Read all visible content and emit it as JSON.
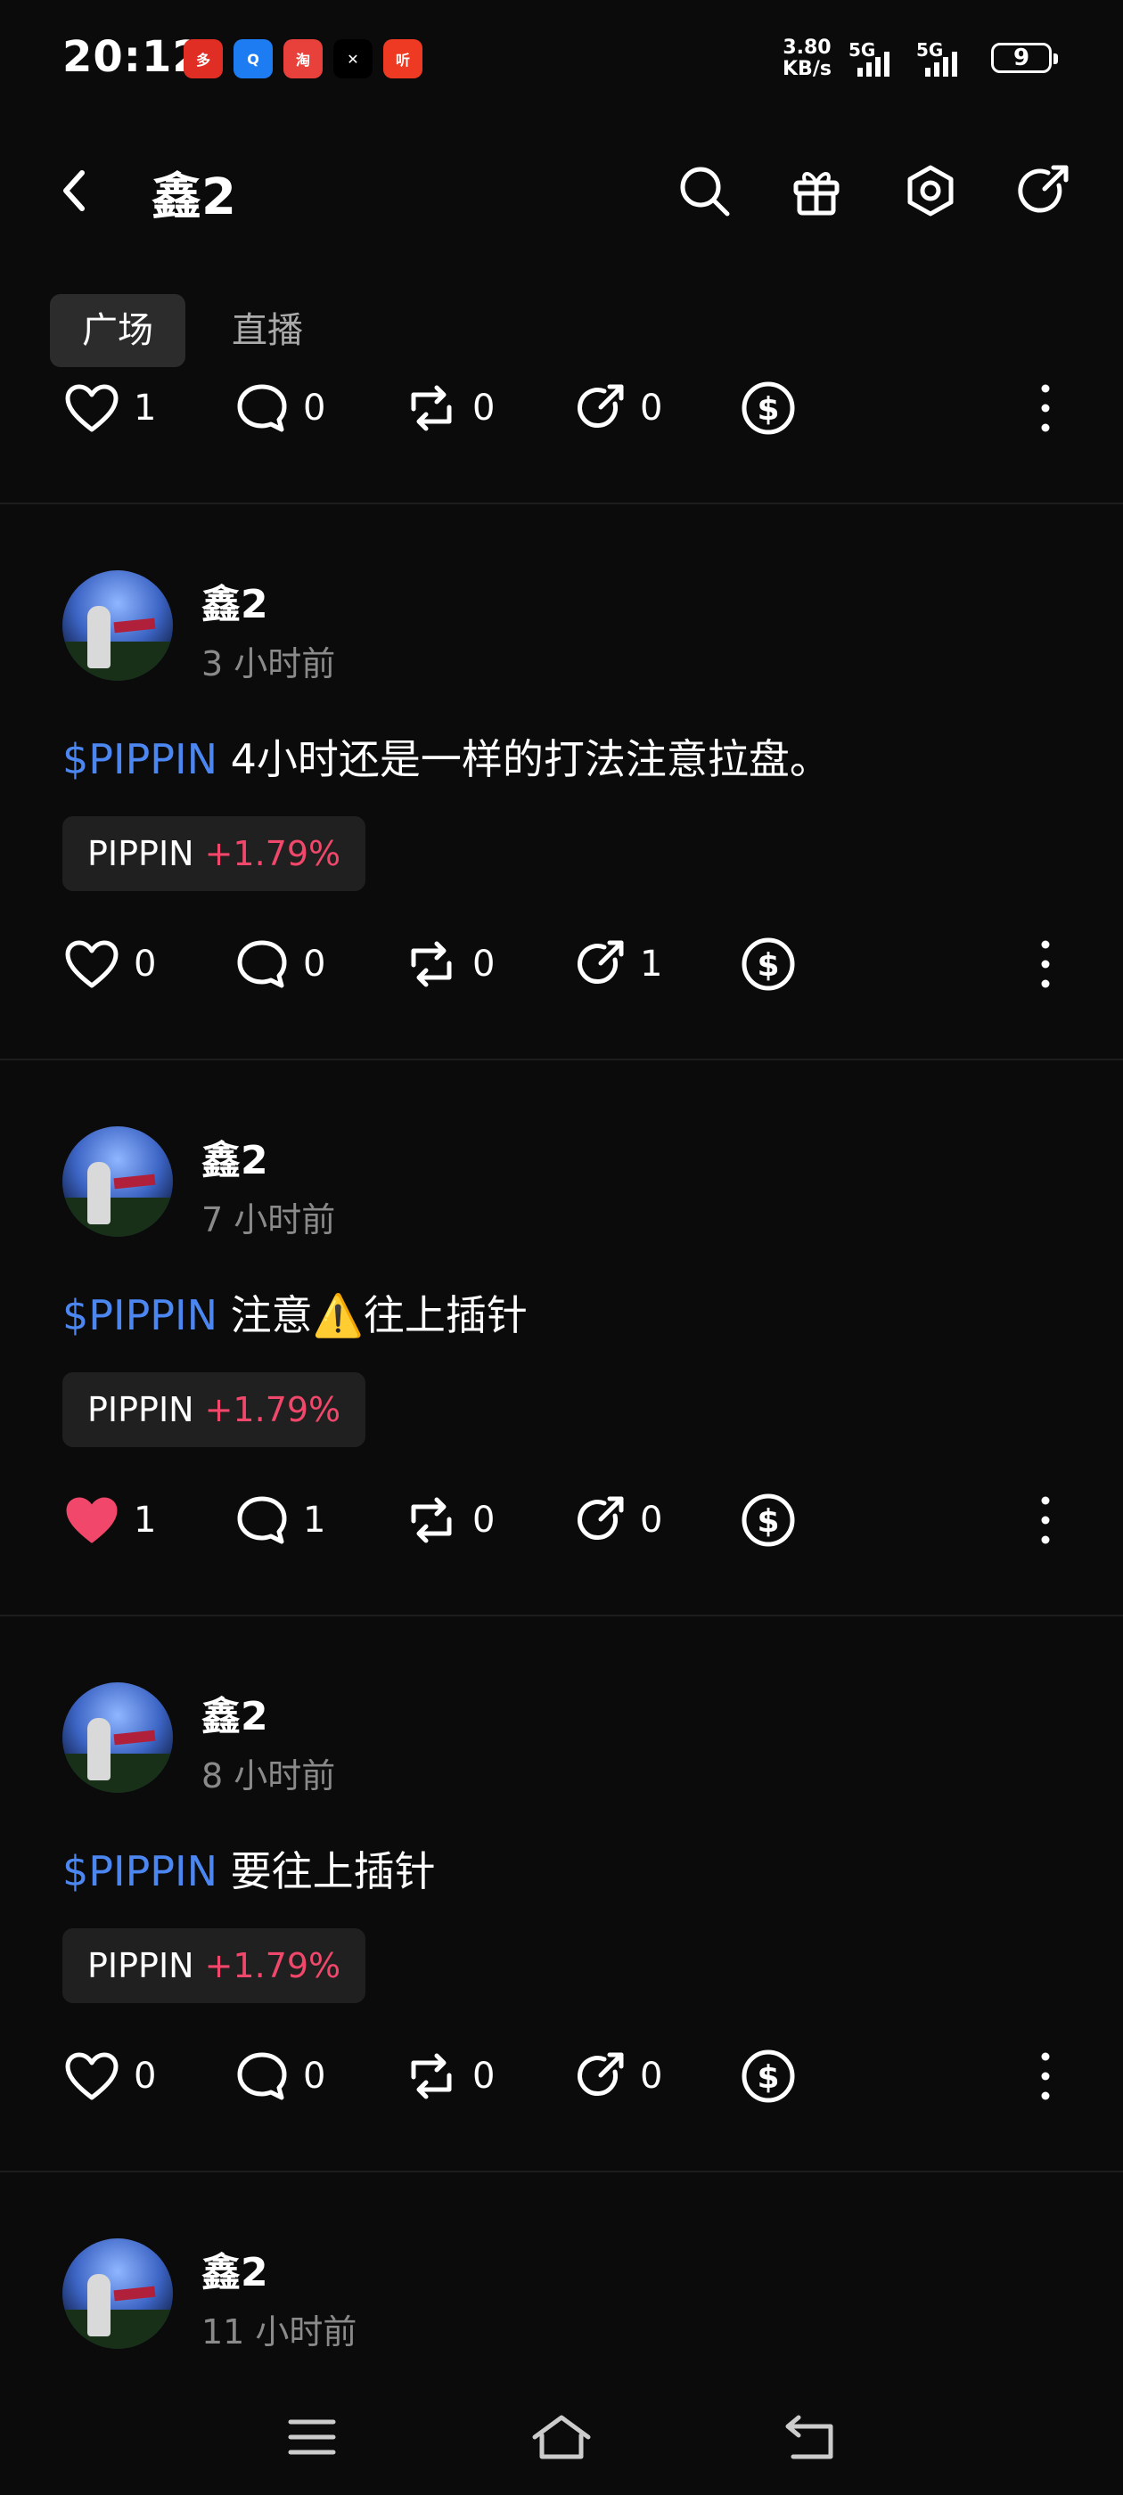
{
  "status": {
    "time": "20:12",
    "net_speed_value": "3.80",
    "net_speed_unit": "KB/s",
    "signal1_label": "5G",
    "signal2_label": "5G",
    "battery": "9",
    "app_icons": [
      {
        "name": "pinduoduo-app-icon",
        "label": "多",
        "color": "#e02e24"
      },
      {
        "name": "qq-browser-app-icon",
        "label": "Q",
        "color": "#1e7cf2"
      },
      {
        "name": "taobao-app-icon",
        "label": "淘",
        "color": "#e8413b"
      },
      {
        "name": "okx-app-icon",
        "label": "✕",
        "color": "#000000"
      },
      {
        "name": "ting-app-icon",
        "label": "听",
        "color": "#ee3a22"
      }
    ]
  },
  "header": {
    "title": "鑫2"
  },
  "tabs": [
    {
      "label": "广场",
      "active": true
    },
    {
      "label": "直播",
      "active": false
    }
  ],
  "top_actions": {
    "like": "1",
    "comment": "0",
    "repost": "0",
    "share": "0"
  },
  "posts": [
    {
      "author": "鑫2",
      "time": "3 小时前",
      "tag": "$PIPPIN",
      "text": " 4小时还是一样的打法注意拉盘。",
      "chip_symbol": "PIPPIN",
      "chip_change": "+1.79%",
      "liked": false,
      "like": "0",
      "comment": "0",
      "repost": "0",
      "share": "1"
    },
    {
      "author": "鑫2",
      "time": "7 小时前",
      "tag": "$PIPPIN",
      "text": " 注意⚠️往上插针",
      "chip_symbol": "PIPPIN",
      "chip_change": "+1.79%",
      "liked": true,
      "like": "1",
      "comment": "1",
      "repost": "0",
      "share": "0"
    },
    {
      "author": "鑫2",
      "time": "8 小时前",
      "tag": "$PIPPIN",
      "text": " 要往上插针",
      "chip_symbol": "PIPPIN",
      "chip_change": "+1.79%",
      "liked": false,
      "like": "0",
      "comment": "0",
      "repost": "0",
      "share": "0"
    },
    {
      "author": "鑫2",
      "time": "11 小时前"
    }
  ],
  "colors": {
    "background": "#0b0b0b",
    "tag_blue": "#4c86f0",
    "positive_change": "#f0476a",
    "liked_heart": "#f0476a"
  }
}
